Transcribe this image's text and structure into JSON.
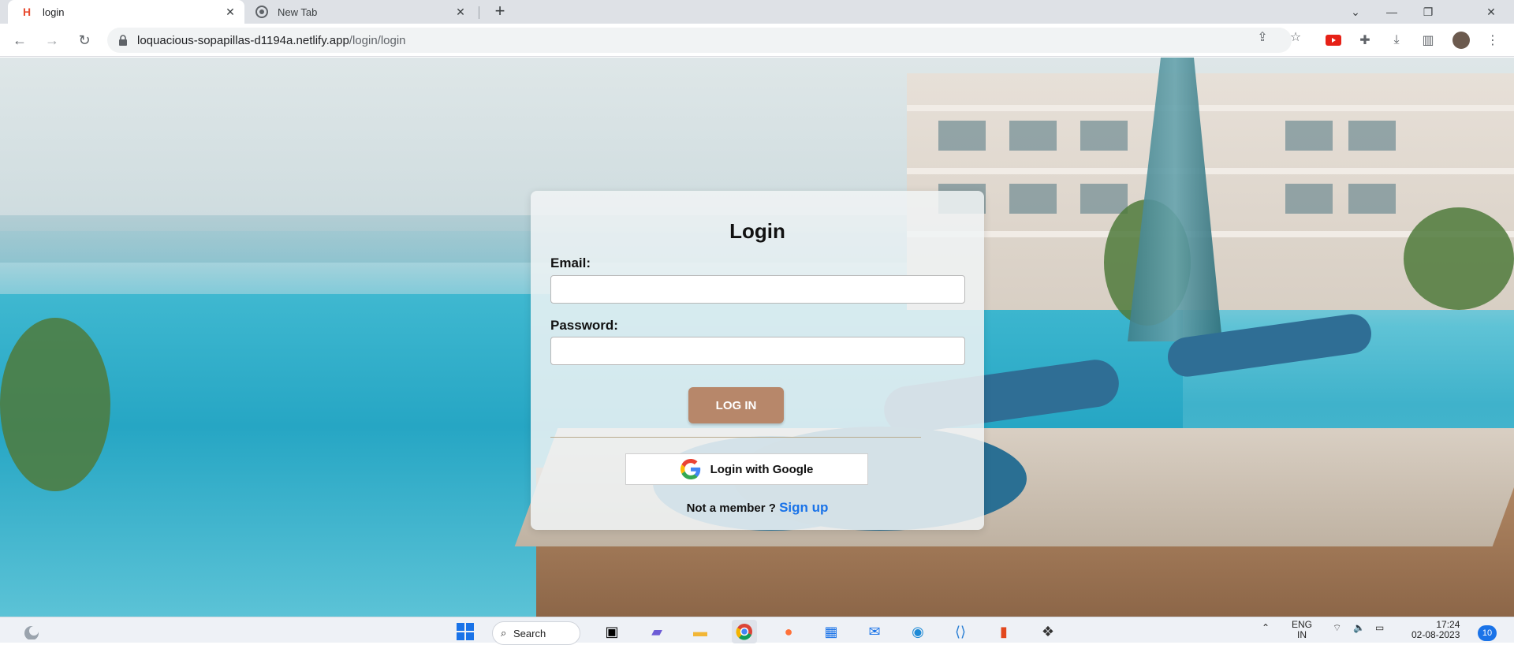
{
  "browser": {
    "tabs": [
      {
        "title": "login",
        "favicon": "H",
        "favicon_color": "#e84a2f",
        "active": true
      },
      {
        "title": "New Tab",
        "favicon": "chrome-icon",
        "active": false
      }
    ],
    "address": {
      "host": "loquacious-sopapillas-d1194a.netlify.app",
      "path": "/login/login"
    }
  },
  "login": {
    "title": "Login",
    "email_label": "Email:",
    "email_value": "",
    "password_label": "Password:",
    "password_value": "",
    "login_button": "LOG IN",
    "google_button": "Login with Google",
    "member_text": "Not a member ?",
    "signup_link": "Sign up",
    "button_color": "#b7876a",
    "link_color": "#1a73e8"
  },
  "taskbar": {
    "search_label": "Search",
    "language_top": "ENG",
    "language_bottom": "IN",
    "time": "17:24",
    "date": "02-08-2023",
    "notification_count": "10"
  }
}
